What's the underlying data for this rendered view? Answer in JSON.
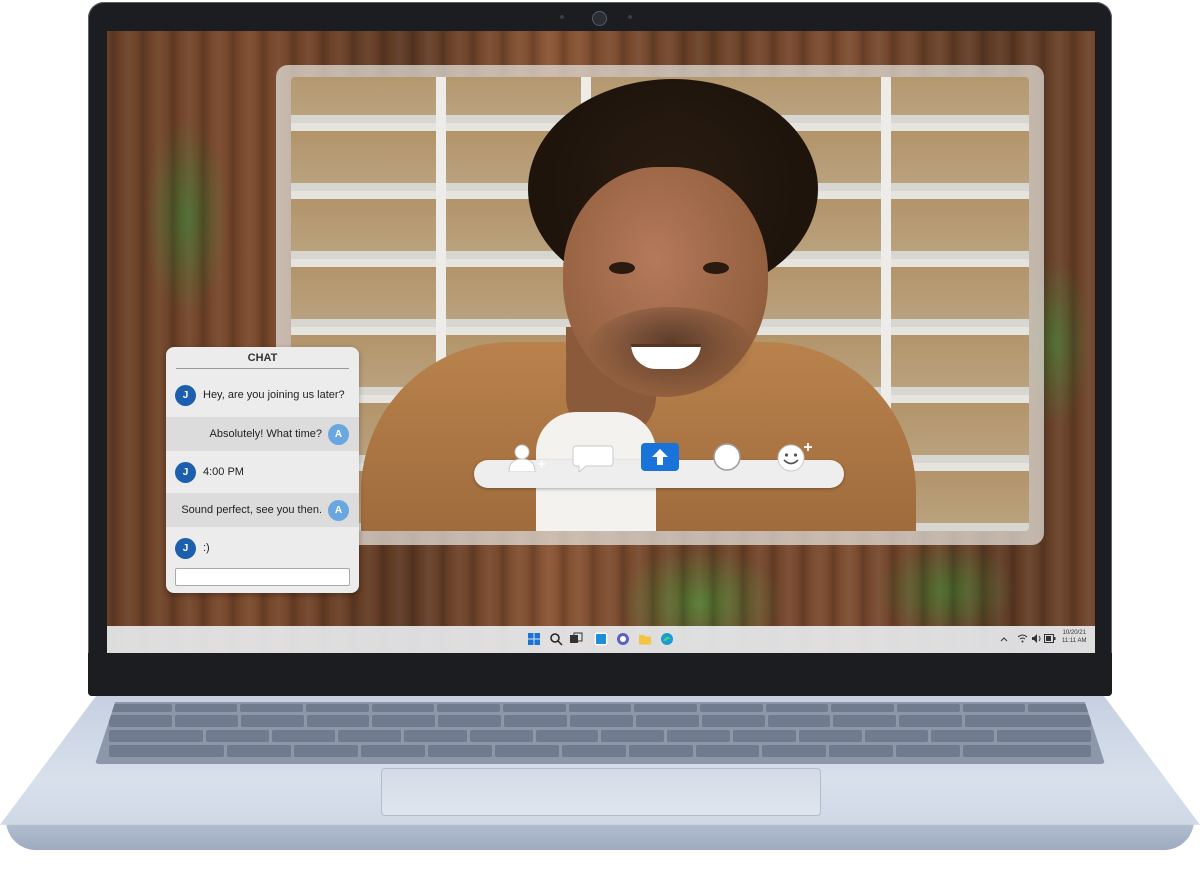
{
  "chat": {
    "title": "CHAT",
    "messages": [
      {
        "avatar": "J",
        "text": "Hey, are you joining us later?",
        "side": "left"
      },
      {
        "avatar": "A",
        "text": "Absolutely! What time?",
        "side": "right"
      },
      {
        "avatar": "J",
        "text": "4:00 PM",
        "side": "left"
      },
      {
        "avatar": "A",
        "text": "Sound perfect, see you then.",
        "side": "right"
      },
      {
        "avatar": "J",
        "text": ":)",
        "side": "left"
      }
    ],
    "input_value": ""
  },
  "video_controls": {
    "icons": [
      "add-person-icon",
      "chat-bubble-icon",
      "share-upload-icon",
      "record-circle-icon",
      "emoji-add-icon"
    ]
  },
  "taskbar": {
    "icons": [
      "windows-start-icon",
      "search-icon",
      "task-view-icon",
      "widgets-icon",
      "teams-chat-icon",
      "file-explorer-icon",
      "edge-browser-icon"
    ],
    "date": "10/20/21",
    "time": "11:11 AM"
  },
  "colors": {
    "avatar_j": "#1c5fae",
    "avatar_a": "#6aa6e0",
    "share_button": "#1a73d9"
  }
}
